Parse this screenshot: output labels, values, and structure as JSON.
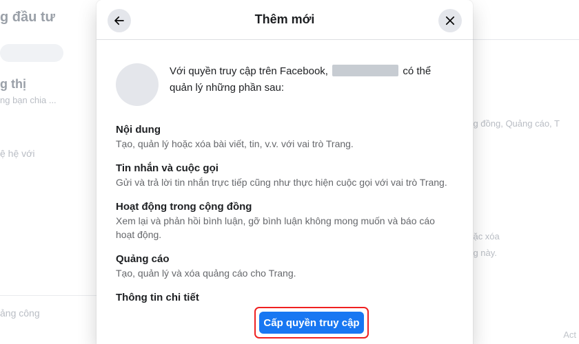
{
  "background": {
    "title": "g đầu tư",
    "line_1": "g thị",
    "line_2": "ng bạn chia ...",
    "line_3": "ệ hệ với",
    "line_4": "ảng công",
    "right_1": "ộng đồng, Quảng cáo, T",
    "right_2": "hoặc xóa",
    "right_3": "ang này.",
    "activate_text": "Act"
  },
  "modal": {
    "title": "Thêm mới",
    "back_icon": "arrow-left-icon",
    "close_icon": "close-icon",
    "intro": {
      "before": "Với quyền truy cập trên Facebook,",
      "redacted": "",
      "after": "có thể quản lý những phần sau:"
    },
    "permissions": [
      {
        "title": "Nội dung",
        "desc": "Tạo, quản lý hoặc xóa bài viết, tin, v.v. với vai trò Trang."
      },
      {
        "title": "Tin nhắn và cuộc gọi",
        "desc": "Gửi và trả lời tin nhắn trực tiếp cũng như thực hiện cuộc gọi với vai trò Trang."
      },
      {
        "title": "Hoạt động trong cộng đồng",
        "desc": "Xem lại và phản hồi bình luận, gỡ bình luận không mong muốn và báo cáo hoạt động."
      },
      {
        "title": "Quảng cáo",
        "desc": "Tạo, quản lý và xóa quảng cáo cho Trang."
      },
      {
        "title": "Thông tin chi tiết",
        "desc": ""
      }
    ],
    "cta_label": "Cấp quyền truy cập"
  },
  "colors": {
    "accent": "#1877f2",
    "highlight_border": "#ef2020",
    "text_primary": "#1c1e21",
    "text_secondary": "#65676b",
    "chip": "#e4e6eb"
  }
}
